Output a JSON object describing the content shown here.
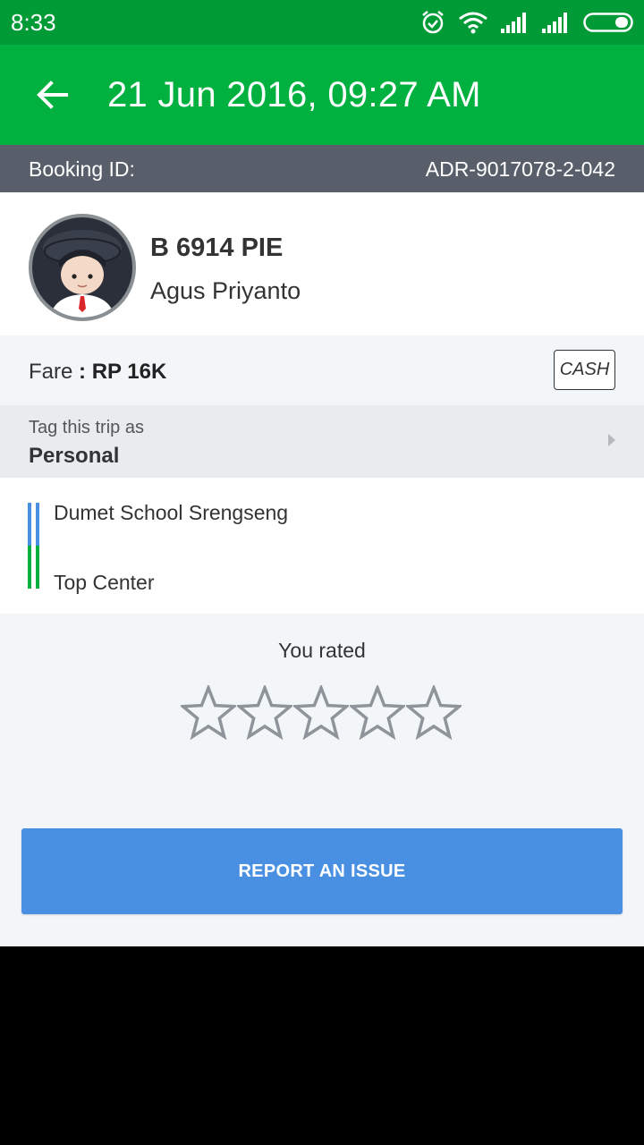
{
  "status_bar": {
    "time": "8:33",
    "icons": [
      "alarm-icon",
      "wifi-icon",
      "signal-icon",
      "signal-icon",
      "battery-icon"
    ]
  },
  "app_bar": {
    "title": "21 Jun 2016, 09:27 AM",
    "back_icon": "back-arrow-icon"
  },
  "booking": {
    "label": "Booking ID:",
    "value": "ADR-9017078-2-042"
  },
  "driver": {
    "plate": "B 6914 PIE",
    "name": "Agus Priyanto"
  },
  "fare": {
    "label": "Fare",
    "value": ": RP 16K",
    "payment": "CASH"
  },
  "tag": {
    "label": "Tag this trip as",
    "value": "Personal"
  },
  "route": {
    "pickup": "Dumet School Srengseng",
    "dropoff": "Top Center"
  },
  "rating": {
    "label": "You rated",
    "stars_total": 5,
    "stars_filled": 0
  },
  "actions": {
    "report": "REPORT AN ISSUE"
  },
  "colors": {
    "status_bar": "#009a36",
    "app_bar": "#00b140",
    "booking_bar": "#585f6b",
    "button": "#4a90e2"
  }
}
